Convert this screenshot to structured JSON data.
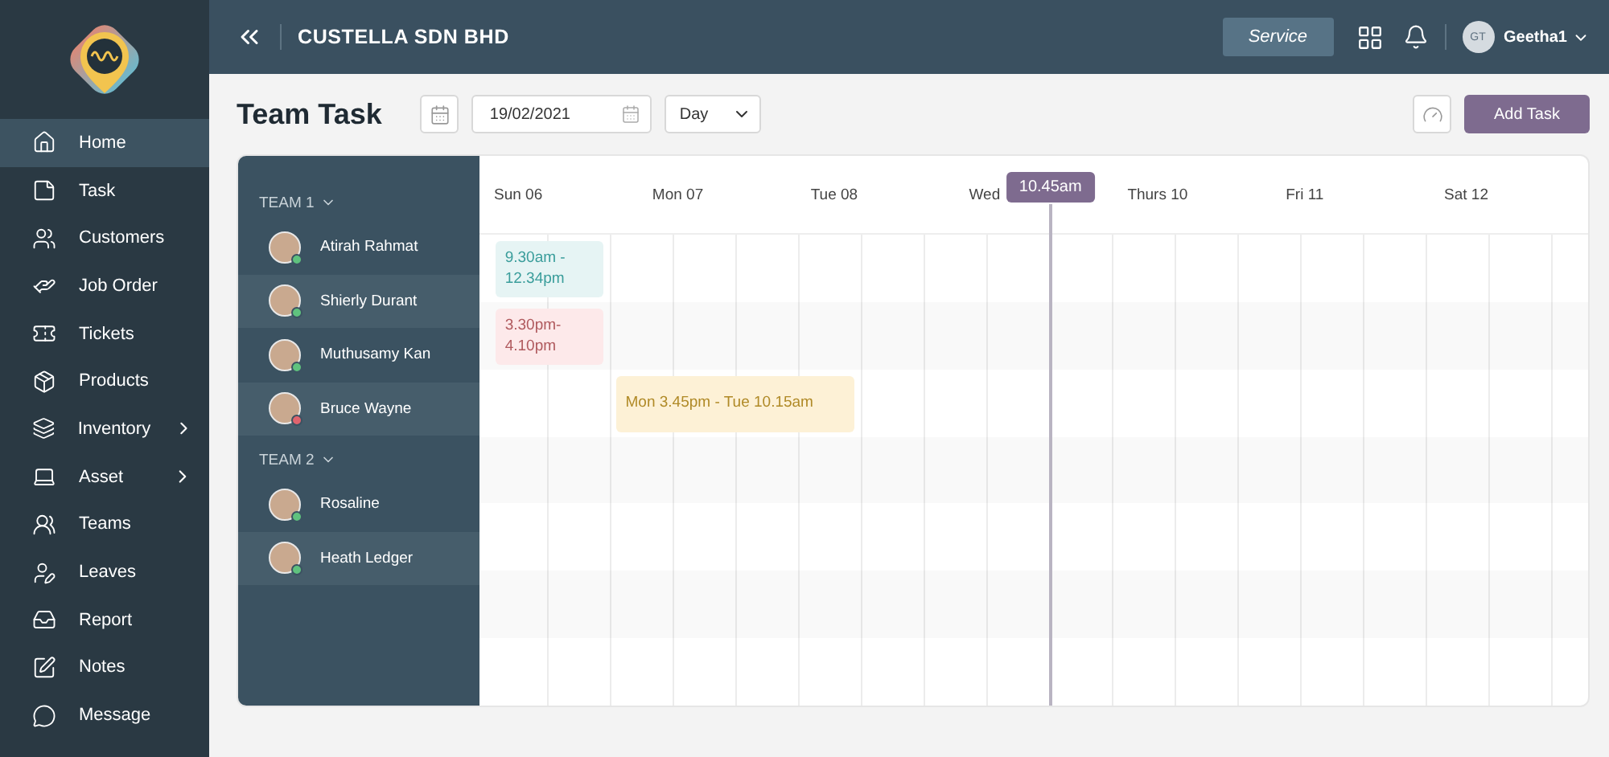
{
  "sidebar": {
    "items": [
      {
        "label": "Home",
        "selected": true,
        "expandable": false
      },
      {
        "label": "Task",
        "selected": false,
        "expandable": false
      },
      {
        "label": "Customers",
        "selected": false,
        "expandable": false
      },
      {
        "label": "Job Order",
        "selected": false,
        "expandable": false
      },
      {
        "label": "Tickets",
        "selected": false,
        "expandable": false
      },
      {
        "label": "Products",
        "selected": false,
        "expandable": false
      },
      {
        "label": "Inventory",
        "selected": false,
        "expandable": true
      },
      {
        "label": "Asset",
        "selected": false,
        "expandable": true
      },
      {
        "label": "Teams",
        "selected": false,
        "expandable": false
      },
      {
        "label": "Leaves",
        "selected": false,
        "expandable": false
      },
      {
        "label": "Report",
        "selected": false,
        "expandable": false
      },
      {
        "label": "Notes",
        "selected": false,
        "expandable": false
      },
      {
        "label": "Message",
        "selected": false,
        "expandable": false
      }
    ]
  },
  "header": {
    "company": "CUSTELLA SDN BHD",
    "service_button": "Service",
    "user": {
      "initials": "GT",
      "name": "Geetha1"
    }
  },
  "toolbar": {
    "title": "Team Task",
    "date": "19/02/2021",
    "view": "Day",
    "add_button": "Add Task"
  },
  "teams": [
    {
      "name": "TEAM 1",
      "expanded": true,
      "members": [
        {
          "name": "Atirah Rahmat",
          "color": "#5fc27e"
        },
        {
          "name": "Shierly Durant",
          "color": "#5fc27e"
        },
        {
          "name": "Muthusamy Kan",
          "color": "#5fc27e"
        },
        {
          "name": "Bruce Wayne",
          "color": "#e0646e"
        }
      ]
    },
    {
      "name": "TEAM 2",
      "expanded": true,
      "members": [
        {
          "name": "Rosaline",
          "color": "#5fc27e"
        },
        {
          "name": "Heath Ledger",
          "color": "#5fc27e"
        }
      ]
    }
  ],
  "calendar": {
    "days": [
      "Sun 06",
      "Mon 07",
      "Tue 08",
      "Wed",
      "Thurs 10",
      "Fri 11",
      "Sat 12"
    ],
    "now": {
      "label": "10.45am"
    },
    "events": [
      {
        "label": "9.30am - 12.34pm",
        "kind": "teal"
      },
      {
        "label": "3.30pm- 4.10pm",
        "kind": "red"
      },
      {
        "label": "Mon 3.45pm - Tue 10.15am",
        "kind": "amber"
      }
    ]
  }
}
